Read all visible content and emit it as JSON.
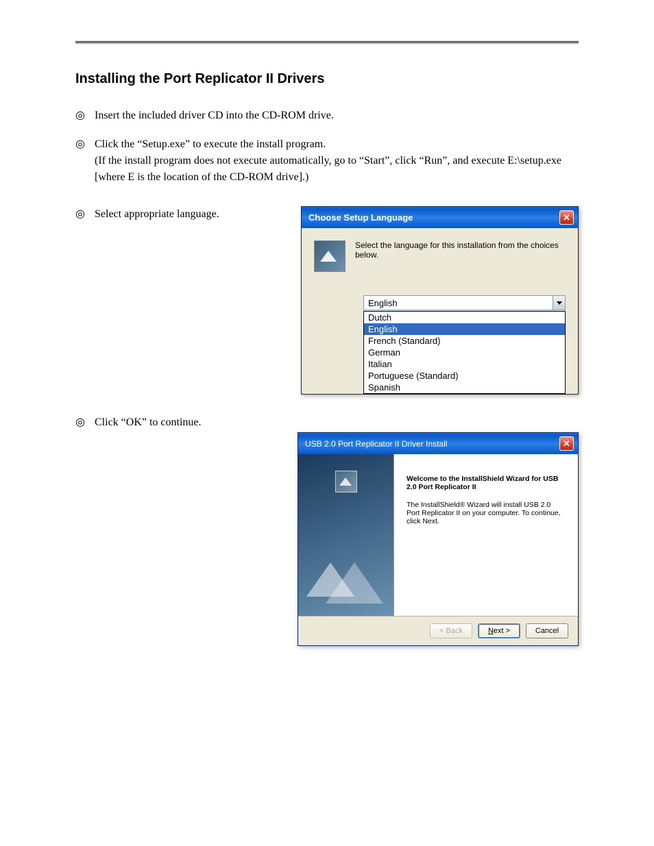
{
  "page": {
    "heading": "Installing the Port Replicator II Drivers",
    "step1": "Insert the included driver CD into the CD-ROM drive.",
    "step2_a": "Click the “Setup.exe” to execute the install program.",
    "step2_b": "(If the install program does not execute automatically, go to “Start”, click “Run”, and execute E:\\setup.exe [where E is the location of the CD-ROM drive].)",
    "step3": "Select appropriate language.",
    "step4": "Click “OK” to continue."
  },
  "dialog1": {
    "title": "Choose Setup Language",
    "message": "Select the language for this installation from the choices below.",
    "selected": "English",
    "options": [
      "Dutch",
      "English",
      "French (Standard)",
      "German",
      "Italian",
      "Portuguese (Standard)",
      "Spanish"
    ]
  },
  "dialog2": {
    "title": "USB 2.0 Port Replicator II Driver Install",
    "welcome": "Welcome to the InstallShield Wizard for USB 2.0 Port Replicator II",
    "desc": "The InstallShield® Wizard will install USB 2.0 Port Replicator II on your computer.  To continue, click Next.",
    "back": "< Back",
    "next": "Next >",
    "cancel": "Cancel"
  }
}
